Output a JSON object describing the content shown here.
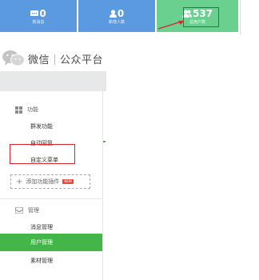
{
  "stats": [
    {
      "value": "0",
      "label": "新消息",
      "icon": "message-icon"
    },
    {
      "value": "0",
      "label": "新增人数",
      "icon": "user-icon"
    },
    {
      "value": "537",
      "label": "总用户数",
      "icon": "users-icon"
    }
  ],
  "logo": {
    "brand": "微信",
    "product": "公众平台"
  },
  "sidebar": {
    "section_function": {
      "label": "功能",
      "icon": "grid-icon",
      "items": [
        "群发功能",
        "自动回复",
        "自定义菜单"
      ]
    },
    "plugin": {
      "label": "添加功能插件",
      "badge": "NEW"
    },
    "section_manage": {
      "label": "管理",
      "icon": "inbox-icon",
      "items": [
        "消息管理",
        "用户管理",
        "素材管理"
      ]
    },
    "active_item": "用户管理"
  },
  "colors": {
    "blue_card": "#5b9ae0",
    "green_card": "#6ad08f",
    "active_green": "#44b549",
    "highlight_red": "#d9232d"
  }
}
